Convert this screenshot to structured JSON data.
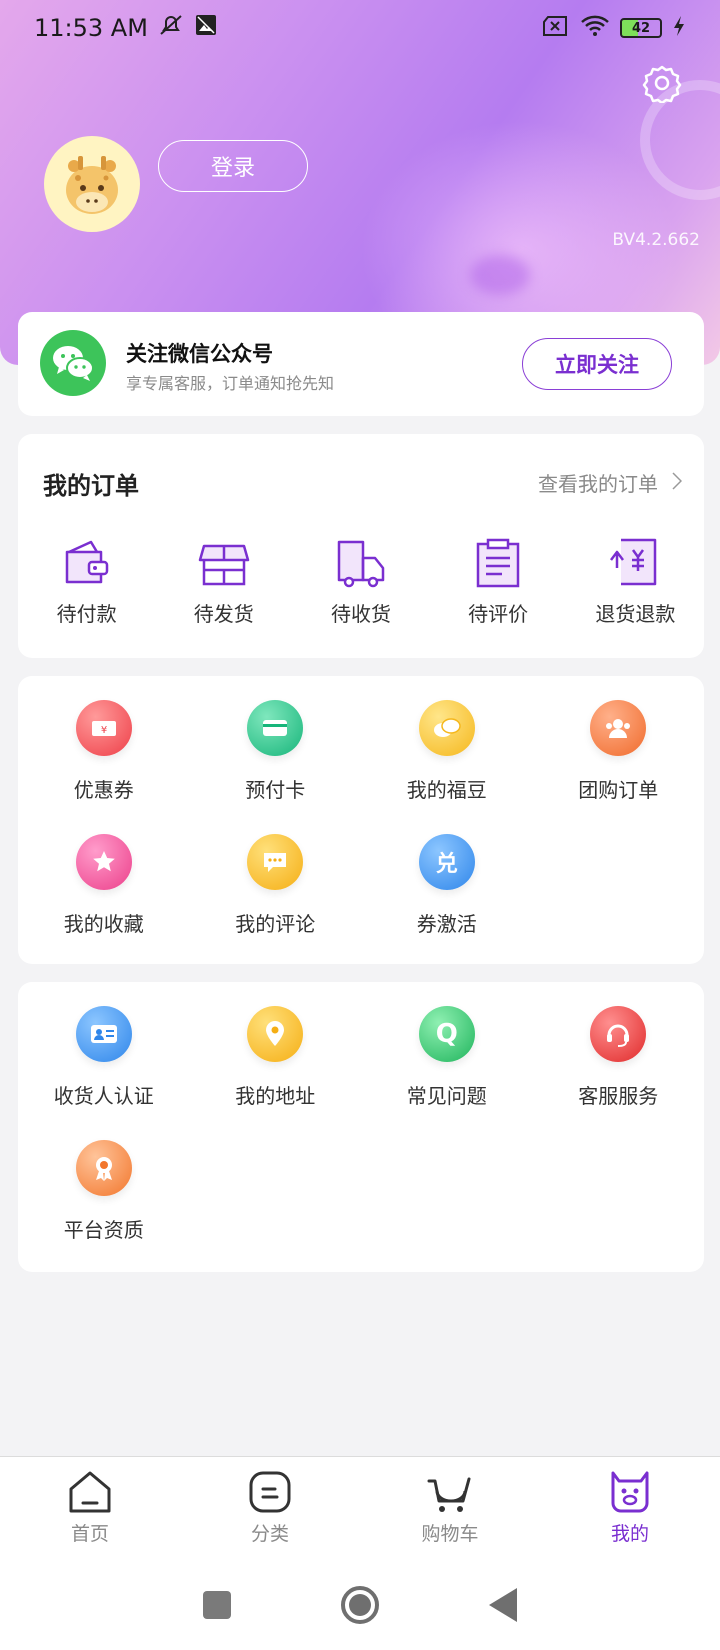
{
  "status_bar": {
    "time": "11:53 AM",
    "battery": "42"
  },
  "profile": {
    "login_label": "登录",
    "version": "BV4.2.662"
  },
  "wechat": {
    "title": "关注微信公众号",
    "subtitle": "享专属客服，订单通知抢先知",
    "follow_label": "立即关注"
  },
  "orders": {
    "title": "我的订单",
    "view_all": "查看我的订单",
    "items": [
      {
        "label": "待付款",
        "icon": "wallet-icon"
      },
      {
        "label": "待发货",
        "icon": "shop-icon"
      },
      {
        "label": "待收货",
        "icon": "truck-icon"
      },
      {
        "label": "待评价",
        "icon": "clipboard-icon"
      },
      {
        "label": "退货退款",
        "icon": "refund-icon"
      }
    ]
  },
  "tools": {
    "items": [
      {
        "label": "优惠券",
        "icon": "coupon-icon",
        "color": "#f0525a"
      },
      {
        "label": "预付卡",
        "icon": "card-icon",
        "color": "#22c48a"
      },
      {
        "label": "我的福豆",
        "icon": "bean-icon",
        "color": "#f7c230"
      },
      {
        "label": "团购订单",
        "icon": "group-icon",
        "color": "#f77a3a"
      },
      {
        "label": "我的收藏",
        "icon": "star-icon",
        "color": "#f35096"
      },
      {
        "label": "我的评论",
        "icon": "comment-icon",
        "color": "#f7bd30"
      },
      {
        "label": "券激活",
        "icon": "activate-icon",
        "color": "#3f9af2",
        "glyph": "兑"
      }
    ]
  },
  "services": {
    "items": [
      {
        "label": "收货人认证",
        "icon": "id-card-icon",
        "color": "#3f9af2"
      },
      {
        "label": "我的地址",
        "icon": "location-icon",
        "color": "#f7bd30"
      },
      {
        "label": "常见问题",
        "icon": "faq-icon",
        "color": "#2fc56e",
        "glyph": "Q"
      },
      {
        "label": "客服服务",
        "icon": "headset-icon",
        "color": "#ee3b3b"
      },
      {
        "label": "平台资质",
        "icon": "badge-icon",
        "color": "#f7803a"
      }
    ]
  },
  "bottom_nav": {
    "items": [
      {
        "label": "首页",
        "icon": "home-icon"
      },
      {
        "label": "分类",
        "icon": "category-icon"
      },
      {
        "label": "购物车",
        "icon": "cart-icon"
      },
      {
        "label": "我的",
        "icon": "mine-icon",
        "active": true
      }
    ]
  }
}
